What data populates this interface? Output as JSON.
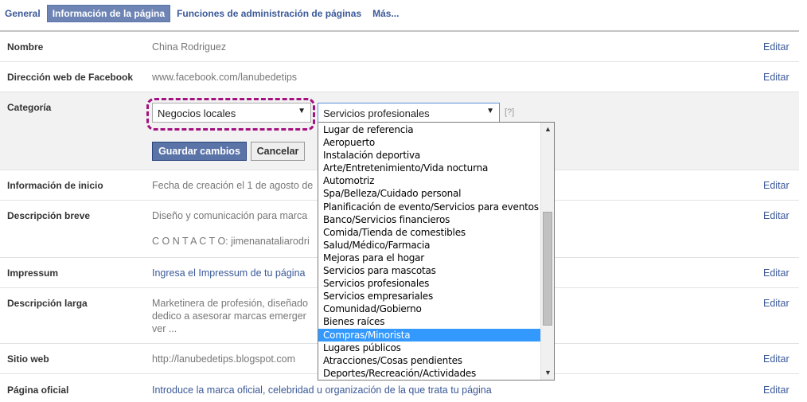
{
  "tabs": [
    "General",
    "Información de la página",
    "Funciones de administración de páginas",
    "Más..."
  ],
  "active_tab": 1,
  "edit_label": "Editar",
  "rows": {
    "nombre": {
      "label": "Nombre",
      "value": "China Rodriguez"
    },
    "direccion": {
      "label": "Dirección web de Facebook",
      "value": "www.facebook.com/lanubedetips"
    },
    "categoria": {
      "label": "Categoría"
    },
    "inicio": {
      "label": "Información de inicio",
      "value": "Fecha de creación el 1 de agosto de"
    },
    "breve": {
      "label": "Descripción breve",
      "value": "Diseño y comunicación para marca",
      "contact": "C O N T A C T O: jimenanataliarodri"
    },
    "impressum": {
      "label": "Impressum",
      "value": "Ingresa el Impressum de tu página"
    },
    "larga": {
      "label": "Descripción larga",
      "line1": "Marketinera de profesión, diseñado",
      "line2": "dedico a asesorar marcas emerger",
      "line3": "ver ..."
    },
    "sitio": {
      "label": "Sitio web",
      "value": "http://lanubedetips.blogspot.com"
    },
    "oficial": {
      "label": "Página oficial",
      "value": "Introduce la marca oficial, celebridad u organización de la que trata tu página"
    }
  },
  "category": {
    "select1": "Negocios locales",
    "select2": "Servicios profesionales",
    "help": "[?]",
    "save": "Guardar cambios",
    "cancel": "Cancelar",
    "options": [
      "Lugar de referencia",
      "Aeropuerto",
      "Instalación deportiva",
      "Arte/Entretenimiento/Vida nocturna",
      "Automotriz",
      "Spa/Belleza/Cuidado personal",
      "Planificación de evento/Servicios para eventos",
      "Banco/Servicios financieros",
      "Comida/Tienda de comestibles",
      "Salud/Médico/Farmacia",
      "Mejoras para el hogar",
      "Servicios para mascotas",
      "Servicios profesionales",
      "Servicios empresariales",
      "Comunidad/Gobierno",
      "Bienes raíces",
      "Compras/Minorista",
      "Lugares públicos",
      "Atracciones/Cosas pendientes",
      "Deportes/Recreación/Actividades"
    ],
    "highlighted_option": 16
  },
  "colors": {
    "link": "#3b5998",
    "tab_active": "#6d84b4",
    "highlight": "#3399ff",
    "annotation": "#a3127f"
  }
}
